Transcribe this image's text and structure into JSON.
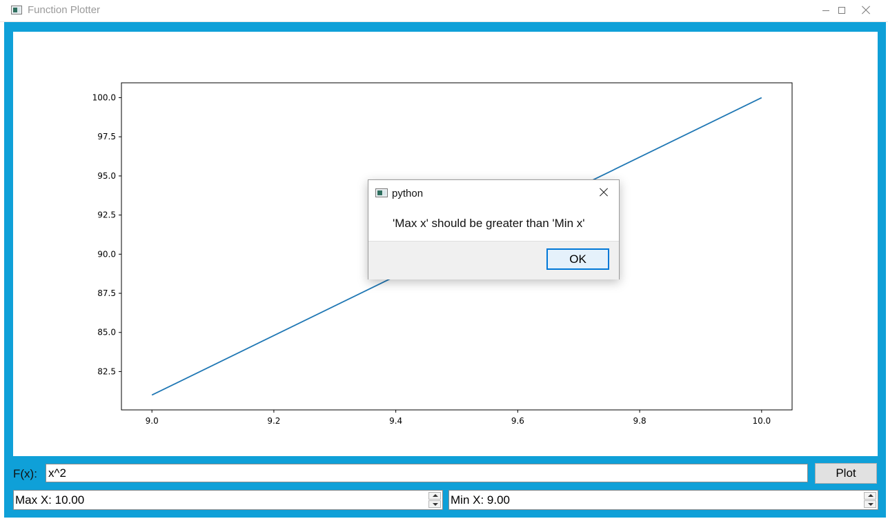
{
  "window": {
    "title": "Function Plotter",
    "accent_color": "#0fa0d8"
  },
  "chart_data": {
    "type": "line",
    "x": [
      9.0,
      10.0
    ],
    "y": [
      81.0,
      100.0
    ],
    "series": [
      {
        "values": [
          81.0,
          100.0
        ],
        "color": "#1f77b4"
      }
    ],
    "xticks": [
      "9.0",
      "9.2",
      "9.4",
      "9.6",
      "9.8",
      "10.0"
    ],
    "yticks": [
      "82.5",
      "85.0",
      "87.5",
      "90.0",
      "92.5",
      "95.0",
      "97.5",
      "100.0"
    ],
    "xlim": [
      8.95,
      10.05
    ],
    "ylim": [
      80.05,
      100.95
    ],
    "title": "",
    "xlabel": "",
    "ylabel": "",
    "grid": false
  },
  "controls": {
    "fx_label": "F(x):",
    "fx_value": "x^2",
    "plot_button": "Plot",
    "max_x": "Max X: 10.00",
    "min_x": "Min X: 9.00"
  },
  "dialog": {
    "title": "python",
    "message": "'Max x' should be greater than 'Min x'",
    "ok_button": "OK"
  }
}
